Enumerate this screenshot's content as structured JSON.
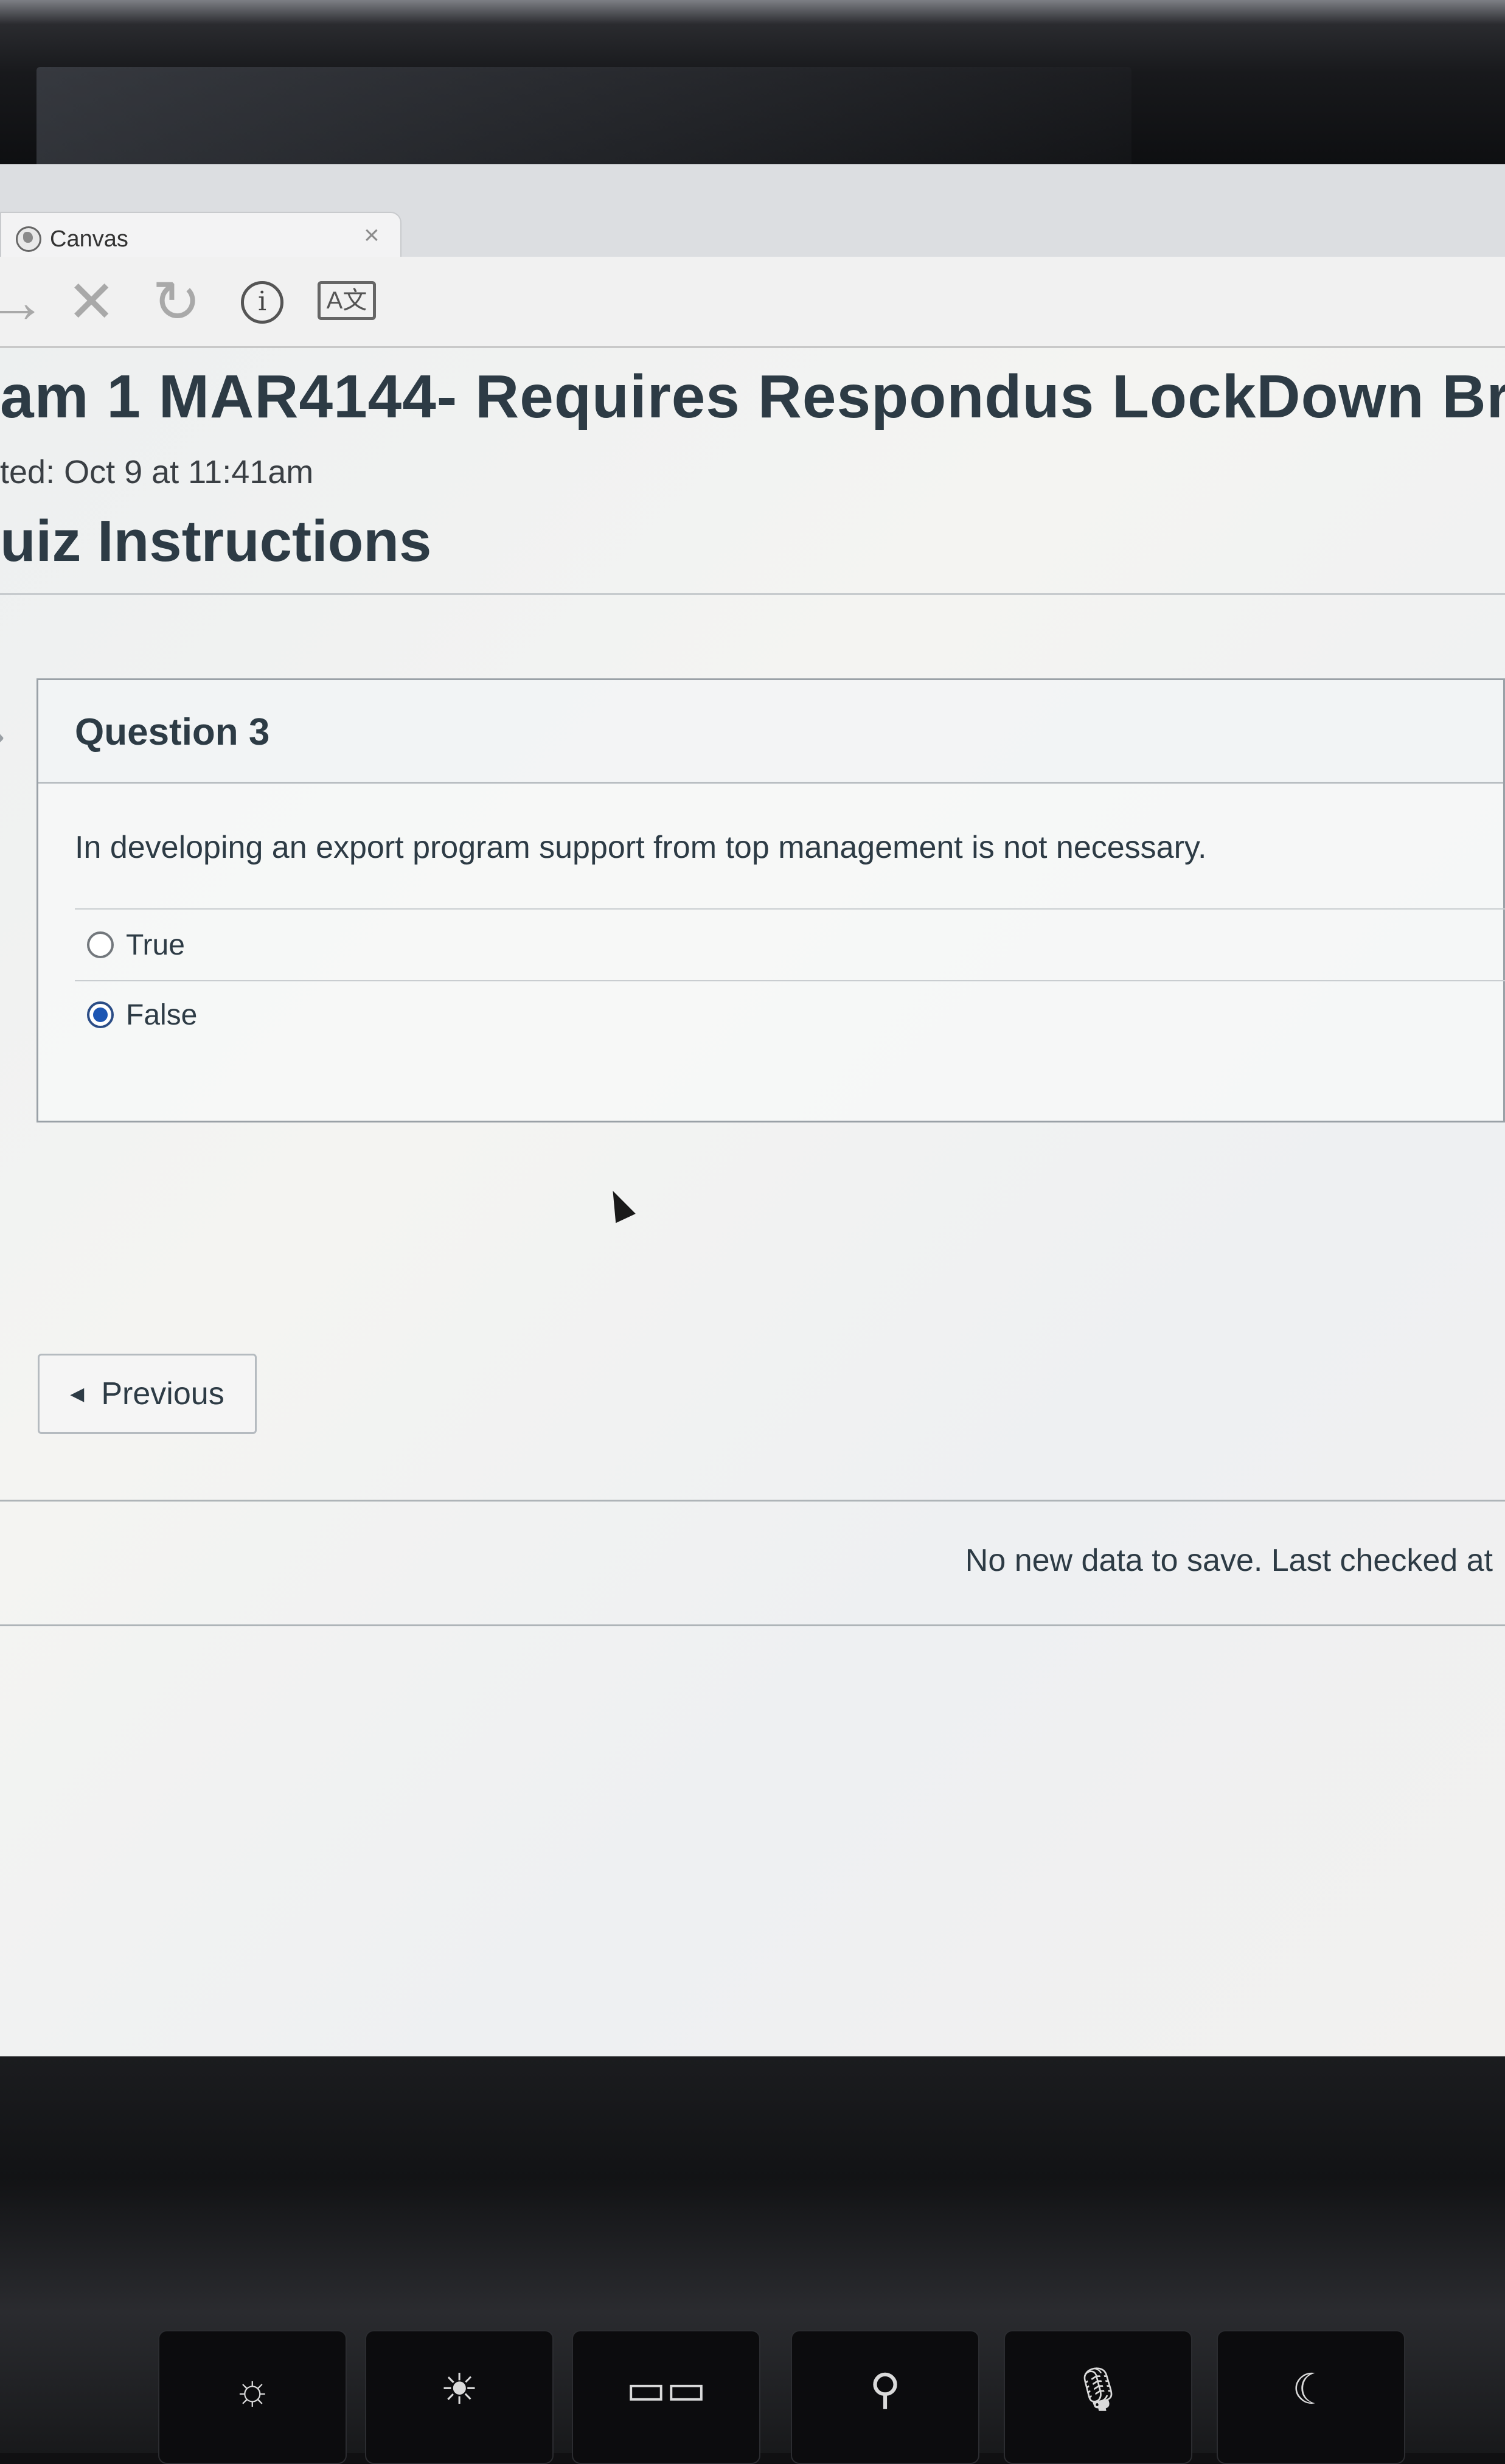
{
  "browser": {
    "tab_title": "Canvas",
    "tab_close": "×",
    "toolbar": {
      "forward_icon": "→",
      "stop_icon": "✕",
      "reload_icon": "↻",
      "info_icon": "i",
      "translate_icon": "A文"
    }
  },
  "quiz": {
    "title": "am 1 MAR4144- Requires Respondus LockDown Browser",
    "started": "ted: Oct 9 at 11:41am",
    "instructions_heading": "uiz Instructions"
  },
  "question": {
    "header": "Question 3",
    "text": "In developing an export program support from top management is not necessary.",
    "answers": [
      {
        "label": "True",
        "selected": false
      },
      {
        "label": "False",
        "selected": true
      }
    ]
  },
  "navigation": {
    "previous_label": "Previous"
  },
  "status": {
    "save_message": "No new data to save. Last checked at"
  },
  "keyboard": {
    "keys": [
      "☼",
      "☀",
      "▭▭",
      "⚲",
      "🎙",
      "☾"
    ]
  },
  "colors": {
    "text": "#2d3b45",
    "radio_selected": "#1d56b3"
  }
}
